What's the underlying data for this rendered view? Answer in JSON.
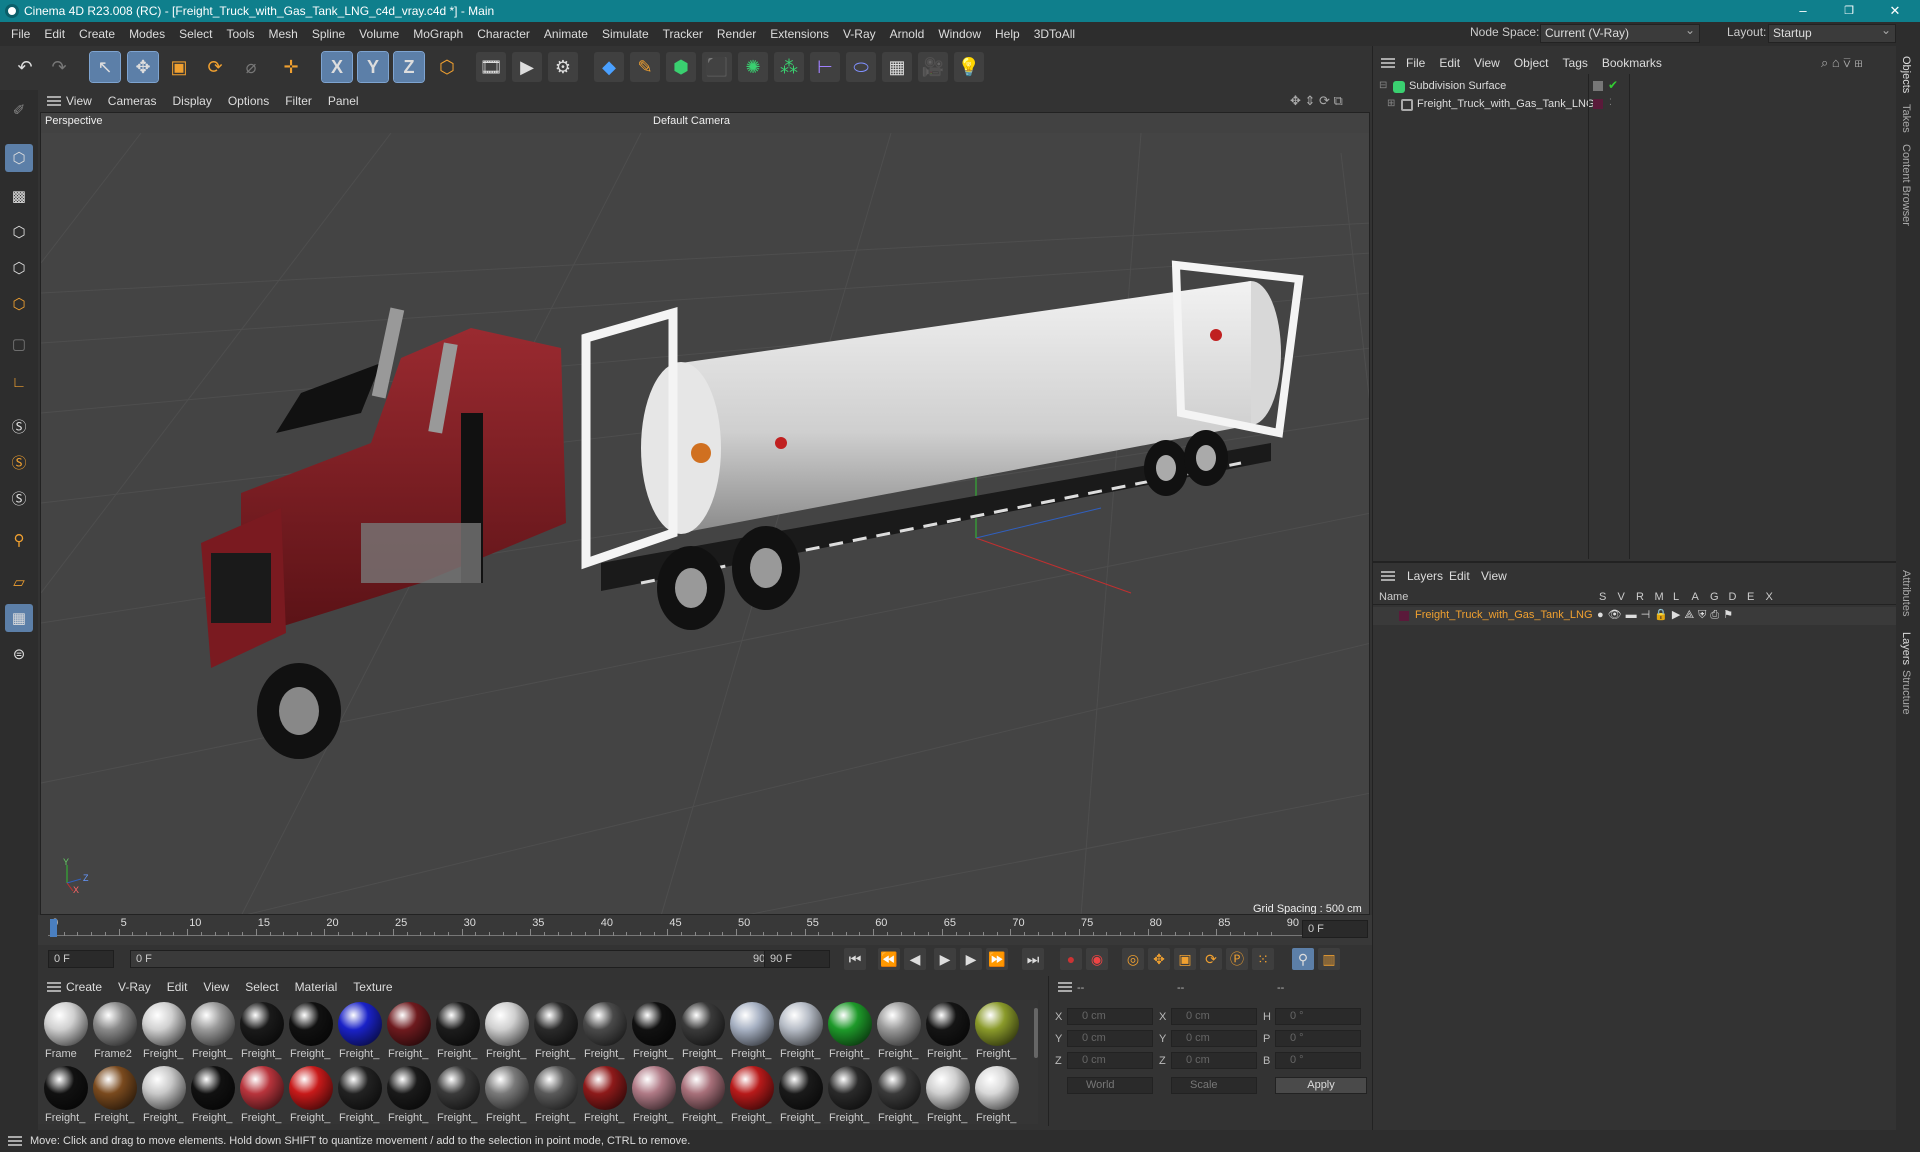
{
  "window": {
    "title": "Cinema 4D R23.008 (RC) - [Freight_Truck_with_Gas_Tank_LNG_c4d_vray.c4d *] - Main",
    "minimize": "–",
    "maximize": "❐",
    "close": "✕"
  },
  "menubar": {
    "items": [
      "File",
      "Edit",
      "Create",
      "Modes",
      "Select",
      "Tools",
      "Mesh",
      "Spline",
      "Volume",
      "MoGraph",
      "Character",
      "Animate",
      "Simulate",
      "Tracker",
      "Render",
      "Extensions",
      "V-Ray",
      "Arnold",
      "Window",
      "Help",
      "3DToAll"
    ],
    "node_space_label": "Node Space:",
    "node_space_value": "Current (V-Ray)",
    "layout_label": "Layout:",
    "layout_value": "Startup"
  },
  "toolbar": {
    "axis_x": "X",
    "axis_y": "Y",
    "axis_z": "Z"
  },
  "viewport": {
    "menu": [
      "View",
      "Cameras",
      "Display",
      "Options",
      "Filter",
      "Panel"
    ],
    "name": "Perspective",
    "camera": "Default Camera",
    "grid_spacing": "Grid Spacing : 500 cm",
    "axis_x": "X",
    "axis_y": "Y",
    "axis_z": "Z"
  },
  "timeline": {
    "ticks": [
      "0",
      "5",
      "10",
      "15",
      "20",
      "25",
      "30",
      "35",
      "40",
      "45",
      "50",
      "55",
      "60",
      "65",
      "70",
      "75",
      "80",
      "85",
      "90"
    ],
    "current_frame": "0 F"
  },
  "playbar": {
    "start": "0 F",
    "range_start": "0 F",
    "range_end": "90 F",
    "end": "90 F"
  },
  "materials": {
    "menu": [
      "Create",
      "V-Ray",
      "Edit",
      "View",
      "Select",
      "Material",
      "Texture"
    ],
    "row1": [
      {
        "label": "Frame",
        "color": "#cfcfcf"
      },
      {
        "label": "Frame2",
        "color": "#8a8a8a"
      },
      {
        "label": "Freight_",
        "color": "#d0d0d0"
      },
      {
        "label": "Freight_",
        "color": "#9a9a9a"
      },
      {
        "label": "Freight_",
        "color": "#1a1a1a"
      },
      {
        "label": "Freight_",
        "color": "#111111"
      },
      {
        "label": "Freight_",
        "color": "#1a22c8"
      },
      {
        "label": "Freight_",
        "color": "#6e1a1e"
      },
      {
        "label": "Freight_",
        "color": "#1c1c1c"
      },
      {
        "label": "Freight_",
        "color": "#cfcfcf"
      },
      {
        "label": "Freight_",
        "color": "#2a2a2a"
      },
      {
        "label": "Freight_",
        "color": "#4a4a4a"
      },
      {
        "label": "Freight_",
        "color": "#111111"
      },
      {
        "label": "Freight_",
        "color": "#3a3a3a"
      },
      {
        "label": "Freight_",
        "color": "#a7b1c3"
      },
      {
        "label": "Freight_",
        "color": "#b6bcc6"
      },
      {
        "label": "Freight_",
        "color": "#1e9a2a"
      },
      {
        "label": "Freight_",
        "color": "#9a9a9a"
      },
      {
        "label": "Freight_",
        "color": "#151515"
      },
      {
        "label": "Freight_",
        "color": "#8a9a2a"
      }
    ],
    "row2": [
      {
        "label": "Freight_",
        "color": "#111111"
      },
      {
        "label": "Freight_",
        "color": "#7a4a1e"
      },
      {
        "label": "Freight_",
        "color": "#c8c8c8"
      },
      {
        "label": "Freight_",
        "color": "#111111"
      },
      {
        "label": "Freight_",
        "color": "#b8343c"
      },
      {
        "label": "Freight_",
        "color": "#c81a1a"
      },
      {
        "label": "Freight_",
        "color": "#222222"
      },
      {
        "label": "Freight_",
        "color": "#1a1a1a"
      },
      {
        "label": "Freight_",
        "color": "#3a3a3a"
      },
      {
        "label": "Freight_",
        "color": "#7a7a7a"
      },
      {
        "label": "Freight_",
        "color": "#5a5a5a"
      },
      {
        "label": "Freight_",
        "color": "#8e1a1a"
      },
      {
        "label": "Freight_",
        "color": "#b07a86"
      },
      {
        "label": "Freight_",
        "color": "#a8707a"
      },
      {
        "label": "Freight_",
        "color": "#b81a1a"
      },
      {
        "label": "Freight_",
        "color": "#1a1a1a"
      },
      {
        "label": "Freight_",
        "color": "#2a2a2a"
      },
      {
        "label": "Freight_",
        "color": "#3a3a3a"
      },
      {
        "label": "Freight_",
        "color": "#cfcfcf"
      },
      {
        "label": "Freight_",
        "color": "#d8d8d8"
      }
    ]
  },
  "coords": {
    "headers": [
      "--",
      "--",
      "--"
    ],
    "rows": [
      {
        "a": "X",
        "av": "0 cm",
        "b": "X",
        "bv": "0 cm",
        "c": "H",
        "cv": "0 °"
      },
      {
        "a": "Y",
        "av": "0 cm",
        "b": "Y",
        "bv": "0 cm",
        "c": "P",
        "cv": "0 °"
      },
      {
        "a": "Z",
        "av": "0 cm",
        "b": "Z",
        "bv": "0 cm",
        "c": "B",
        "cv": "0 °"
      }
    ],
    "space": "World",
    "mode": "Scale",
    "apply": "Apply"
  },
  "objects": {
    "menu": [
      "File",
      "Edit",
      "View",
      "Object",
      "Tags",
      "Bookmarks"
    ],
    "items": [
      {
        "name": "Subdivision Surface"
      },
      {
        "name": "Freight_Truck_with_Gas_Tank_LNG"
      }
    ]
  },
  "layers": {
    "menu": [
      "Layers",
      "Edit",
      "View"
    ],
    "name_header": "Name",
    "flags": [
      "S",
      "V",
      "R",
      "M",
      "L",
      "A",
      "G",
      "D",
      "E",
      "X"
    ],
    "layer_name": "Freight_Truck_with_Gas_Tank_LNG",
    "layer_color": "#5a1a3a"
  },
  "right_tabs": [
    "Objects",
    "Takes",
    "Content Browser",
    "Attributes",
    "Layers",
    "Structure"
  ],
  "status": "Move: Click and drag to move elements. Hold down SHIFT to quantize movement / add to the selection in point mode, CTRL to remove."
}
